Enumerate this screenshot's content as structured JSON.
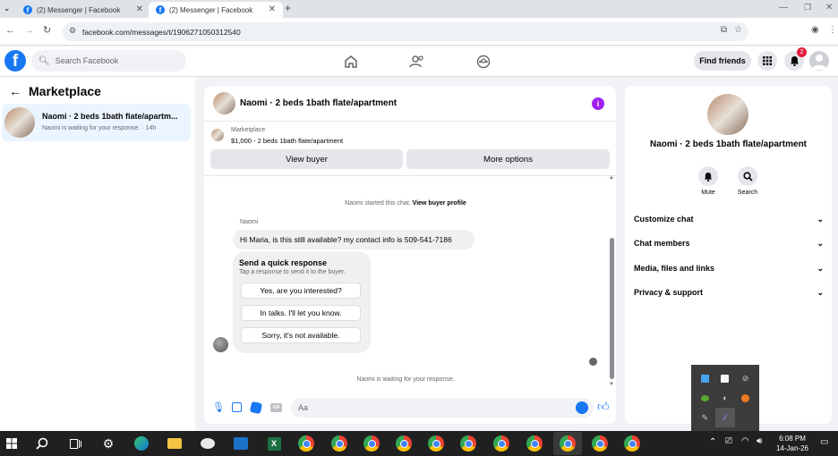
{
  "browser": {
    "tabs": [
      {
        "title": "(2) Messenger | Facebook"
      },
      {
        "title": "(2) Messenger | Facebook"
      }
    ],
    "url": "facebook.com/messages/t/1906271050312540",
    "new_tab": "+"
  },
  "fb_header": {
    "logo": "f",
    "search_placeholder": "Search Facebook",
    "find_friends": "Find friends",
    "notif_count": "2"
  },
  "left": {
    "title": "Marketplace",
    "conversation": {
      "title": "Naomi · 2 beds 1bath flate/apartm...",
      "subtitle": "Naomi is waiting for your response. · 14h"
    }
  },
  "chat": {
    "header_title": "Naomi · 2 beds 1bath flate/apartment",
    "marketplace_label": "Marketplace",
    "listing": "$1,000 - 2 beds 1bath flate/apartment",
    "view_buyer": "View buyer",
    "more_options": "More options",
    "started_text": "Naomi started this chat.",
    "view_buyer_profile": "View buyer profile",
    "sender": "Naomi",
    "message": "Hi Maria, is this still available? my contact info is 509-541-7186",
    "quick_title": "Send a quick response",
    "quick_sub": "Tap a response to send it to the buyer.",
    "quick_responses": [
      "Yes, are you interested?",
      "In talks. I'll let you know.",
      "Sorry, it's not available."
    ],
    "waiting": "Naomi is waiting for your response.",
    "input_placeholder": "Aa"
  },
  "right": {
    "title": "Naomi · 2 beds 1bath flate/apartment",
    "mute": "Mute",
    "search": "Search",
    "sections": [
      "Customize chat",
      "Chat members",
      "Media, files and links",
      "Privacy & support"
    ]
  },
  "taskbar": {
    "time": "6:08 PM",
    "date": "14-Jan-26"
  },
  "colors": {
    "fb_blue": "#1877f2",
    "purple_info": "#a020f0"
  }
}
